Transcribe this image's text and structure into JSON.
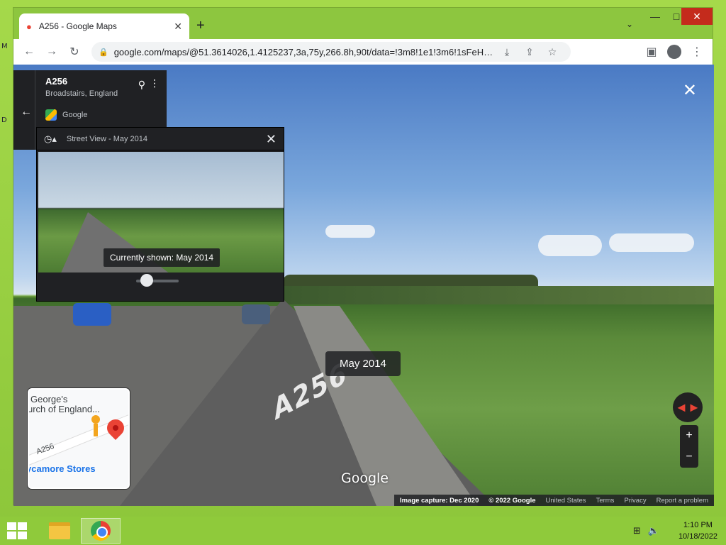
{
  "browser": {
    "tab_title": "A256 - Google Maps",
    "tab_close": "✕",
    "new_tab": "+",
    "url": "google.com/maps/@51.3614026,1.4125237,3a,75y,266.8h,90t/data=!3m8!1e1!3m6!1sFeHkrvVn6e9kv..."
  },
  "place": {
    "title": "A256",
    "subtitle": "Broadstairs, England",
    "source": "Google"
  },
  "timeline": {
    "header": "Street View - May 2014",
    "caption": "Currently shown: May 2014"
  },
  "streetview": {
    "date_badge": "May 2014",
    "road_marking": "A256",
    "watermark": "Google"
  },
  "minimap": {
    "label1": "George's",
    "label2": "urch of England...",
    "road": "A256",
    "store": "ycamore Stores"
  },
  "footer": {
    "capture": "Image capture: Dec 2020",
    "copyright": "© 2022 Google",
    "country": "United States",
    "terms": "Terms",
    "privacy": "Privacy",
    "report": "Report a problem"
  },
  "taskbar": {
    "time": "1:10 PM",
    "date": "10/18/2022"
  },
  "desktop": {
    "glyph1": "M",
    "glyph2": "D"
  },
  "colors": {
    "desktop_bg": "#9bd23b",
    "panel_dark": "#202124",
    "accent_red": "#ea4335"
  }
}
